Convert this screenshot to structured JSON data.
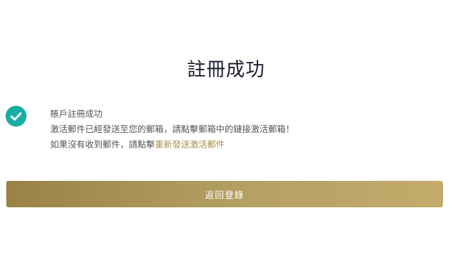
{
  "page": {
    "title": "註冊成功"
  },
  "status": {
    "icon": "check-circle-icon",
    "icon_color": "#1aada5",
    "heading": "賬戶註冊成功",
    "line1": "激活郵件已經發送至您的郵箱，請點擊郵箱中的鏈接激活郵箱！",
    "line2_prefix": "如果沒有收到郵件，請點擊",
    "resend_link": "重新發送激活郵件",
    "link_color": "#a88d4f"
  },
  "actions": {
    "back_label": "返回登錄",
    "button_gradient": [
      "#9a8245",
      "#c3ab6b"
    ]
  }
}
